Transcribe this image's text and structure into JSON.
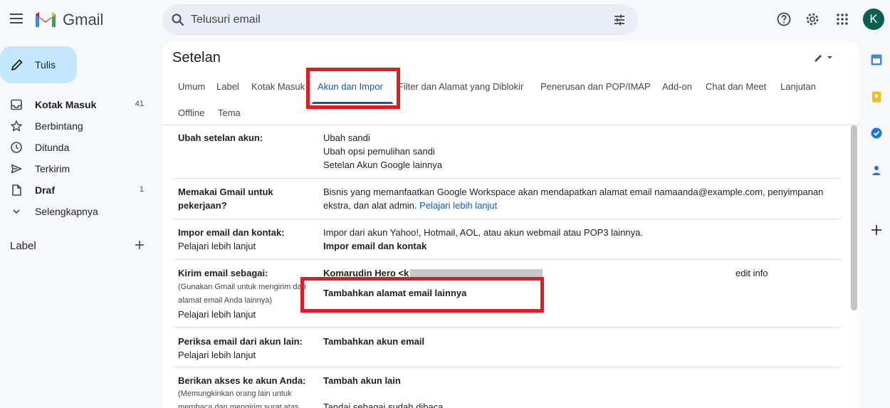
{
  "app": {
    "name": "Gmail"
  },
  "search": {
    "placeholder": "Telusuri email"
  },
  "account": {
    "initial": "K"
  },
  "compose": {
    "label": "Tulis"
  },
  "sidebar": {
    "items": [
      {
        "label": "Kotak Masuk",
        "count": "41",
        "bold": true,
        "icon": "inbox-icon"
      },
      {
        "label": "Berbintang",
        "count": "",
        "bold": false,
        "icon": "star-icon"
      },
      {
        "label": "Ditunda",
        "count": "",
        "bold": false,
        "icon": "clock-icon"
      },
      {
        "label": "Terkirim",
        "count": "",
        "bold": false,
        "icon": "send-icon"
      },
      {
        "label": "Draf",
        "count": "1",
        "bold": true,
        "icon": "draft-icon"
      },
      {
        "label": "Selengkapnya",
        "count": "",
        "bold": false,
        "icon": "chevron-down-icon"
      }
    ],
    "labels_heading": "Label"
  },
  "settings": {
    "title": "Setelan",
    "tabs": [
      {
        "label": "Umum",
        "active": false
      },
      {
        "label": "Label",
        "active": false
      },
      {
        "label": "Kotak Masuk",
        "active": false
      },
      {
        "label": "Akun dan Impor",
        "active": true
      },
      {
        "label": "Filter dan Alamat yang Diblokir",
        "active": false
      },
      {
        "label": "Penerusan dan POP/IMAP",
        "active": false
      },
      {
        "label": "Add-on",
        "active": false
      },
      {
        "label": "Chat dan Meet",
        "active": false
      },
      {
        "label": "Lanjutan",
        "active": false
      },
      {
        "label": "Offline",
        "active": false
      },
      {
        "label": "Tema",
        "active": false
      }
    ],
    "rows": {
      "account": {
        "label": "Ubah setelan akun:",
        "links": [
          "Ubah sandi",
          "Ubah opsi pemulihan sandi",
          "Setelan Akun Google lainnya"
        ]
      },
      "work": {
        "label_line1": "Memakai Gmail untuk",
        "label_line2": "pekerjaan?",
        "text_line1": "Bisnis yang memanfaatkan Google Workspace akan mendapatkan alamat email namaanda@example.com, penyimpanan",
        "text_line2": "ekstra, dan alat admin.",
        "link": "Pelajari lebih lanjut"
      },
      "import": {
        "label": "Impor email dan kontak:",
        "learn": "Pelajari lebih lanjut",
        "text": "Impor dari akun Yahoo!, Hotmail, AOL, atau akun webmail atau POP3 lainnya.",
        "action": "Impor email dan kontak"
      },
      "sendas": {
        "label": "Kirim email sebagai:",
        "note_line1": "(Gunakan Gmail untuk mengirim dari",
        "note_line2": "alamat email Anda lainnya)",
        "learn": "Pelajari lebih lanjut",
        "name": "Komarudin Hero <k",
        "edit": "edit info",
        "add": "Tambahkan alamat email lainnya"
      },
      "check": {
        "label": "Periksa email dari akun lain:",
        "learn": "Pelajari lebih lanjut",
        "action": "Tambahkan akun email"
      },
      "grant": {
        "label": "Berikan akses ke akun Anda:",
        "note_line1": "(Memungkinkan orang lain untuk",
        "note_line2": "membaca dan mengirim surat atas",
        "action": "Tambah akun lain",
        "option": "Tandai sebagai sudah dibaca"
      }
    }
  },
  "highlight_color": "#e01b24",
  "accent_color": "#0b57d0"
}
